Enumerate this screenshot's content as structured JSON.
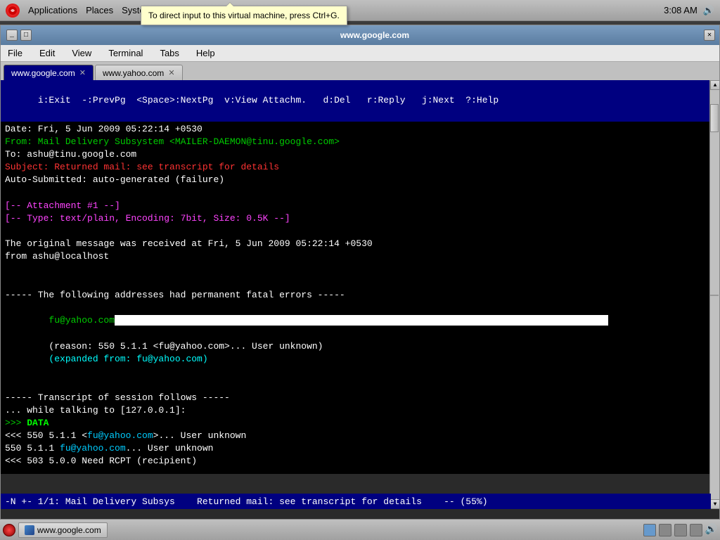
{
  "system_bar": {
    "app_menu": "Applications",
    "places_menu": "Places",
    "system_menu": "System",
    "time": "3:08 AM"
  },
  "tooltip": {
    "text": "To direct input to this virtual machine, press Ctrl+G."
  },
  "terminal": {
    "title": "www.google.com",
    "menu": {
      "file": "File",
      "edit": "Edit",
      "view": "View",
      "terminal": "Terminal",
      "tabs": "Tabs",
      "help": "Help"
    },
    "tabs": [
      {
        "label": "www.google.com",
        "active": true
      },
      {
        "label": "www.yahoo.com",
        "active": false
      }
    ]
  },
  "email": {
    "command_bar": "i:Exit  -:PrevPg  <Space>:NextPg  v:View Attachm.   d:Del   r:Reply   j:Next  ?:Help",
    "date_line": "Date: Fri, 5 Jun 2009 05:22:14 +0530",
    "from_line": "From: Mail Delivery Subsystem <MAILER-DAEMON@tinu.google.com>",
    "to_line": "To: ashu@tinu.google.com",
    "subject_line": "Subject: Returned mail: see transcript for details",
    "auto_submitted": "Auto-Submitted: auto-generated (failure)",
    "blank1": "",
    "blank2": "",
    "attachment1": "[-- Attachment #1 --]",
    "attachment2": "[-- Type: text/plain, Encoding: 7bit, Size: 0.5K --]",
    "blank3": "",
    "original_msg1": "The original message was received at Fri, 5 Jun 2009 05:22:14 +0530",
    "original_msg2": "from ashu@localhost",
    "blank4": "",
    "blank5": "",
    "fatal_errors": "----- The following addresses had permanent fatal errors -----",
    "bad_address": "fu@yahoo.com",
    "reason": "        (reason: 550 5.1.1 <fu@yahoo.com>... User unknown)",
    "expanded": "        (expanded from: fu@yahoo.com)",
    "blank6": "",
    "blank7": "",
    "transcript": "----- Transcript of session follows -----",
    "while_talking": "... while talking to [127.0.0.1]:",
    "data_cmd": ">>> DATA",
    "resp550": "<<< 550 5.1.1 <fu@yahoo.com>... User unknown",
    "error550": "550 5.1.1 fu@yahoo.com... User unknown",
    "resp503": "<<< 503 5.0.0 Need RCPT (recipient)",
    "status_bar": "-N +- 1/1: Mail Delivery Subsys    Returned mail: see transcript for details    -- (55%)"
  },
  "taskbar": {
    "app_label": "www.google.com"
  }
}
